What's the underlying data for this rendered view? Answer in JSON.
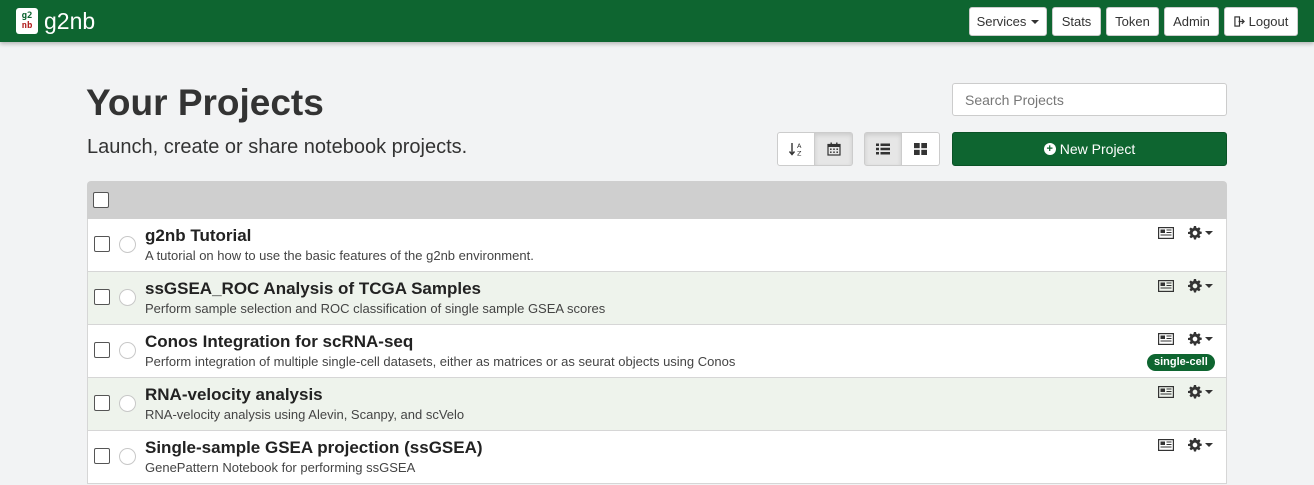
{
  "navbar": {
    "logo_top": "g2",
    "logo_bottom": "nb",
    "brand": "g2nb",
    "services_label": "Services",
    "stats_label": "Stats",
    "token_label": "Token",
    "admin_label": "Admin",
    "logout_label": "Logout",
    "color": "#0e6530"
  },
  "header": {
    "title": "Your Projects",
    "subtitle": "Launch, create or share notebook projects.",
    "search_placeholder": "Search Projects",
    "new_project_label": "New Project"
  },
  "toolbar": {
    "sort_buttons": [
      {
        "icon": "sort-alpha-icon",
        "active": false
      },
      {
        "icon": "calendar-icon",
        "active": true
      }
    ],
    "view_buttons": [
      {
        "icon": "list-view-icon",
        "active": true
      },
      {
        "icon": "grid-view-icon",
        "active": false
      }
    ]
  },
  "projects": [
    {
      "title": "g2nb Tutorial",
      "description": "A tutorial on how to use the basic features of the g2nb environment.",
      "tag": ""
    },
    {
      "title": "ssGSEA_ROC Analysis of TCGA Samples",
      "description": "Perform sample selection and ROC classification of single sample GSEA scores",
      "tag": ""
    },
    {
      "title": "Conos Integration for scRNA-seq",
      "description": "Perform integration of multiple single-cell datasets, either as matrices or as seurat objects using Conos",
      "tag": "single-cell"
    },
    {
      "title": "RNA-velocity analysis",
      "description": "RNA-velocity analysis using Alevin, Scanpy, and scVelo",
      "tag": ""
    },
    {
      "title": "Single-sample GSEA projection (ssGSEA)",
      "description": "GenePattern Notebook for performing ssGSEA",
      "tag": ""
    }
  ]
}
